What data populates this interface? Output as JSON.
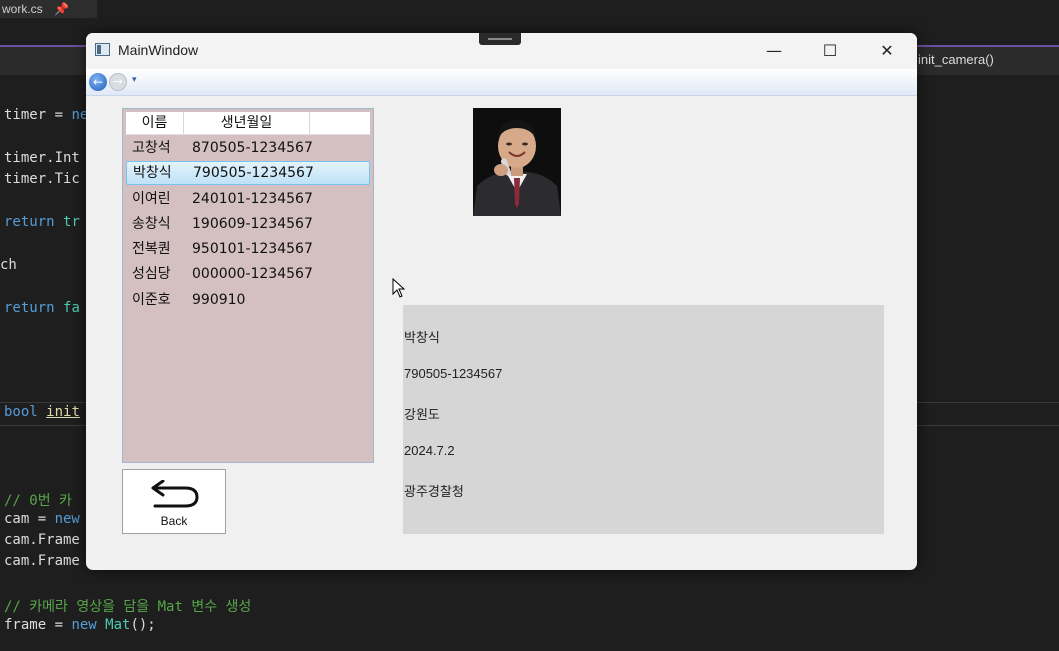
{
  "editor": {
    "tab_label": "work.cs",
    "tab_pin": "❀",
    "nav_function": "init_camera()",
    "lines": {
      "l1": "timer = ",
      "l1b": "ne",
      "l2": "timer.Int",
      "l3": "timer.Tic",
      "l4": "return ",
      "l4b": "tr",
      "l5": "ch",
      "l6": "return ",
      "l6b": "fa",
      "l7a": "bool ",
      "l7b": "init",
      "l8": "// 0번 카",
      "l9a": "cam = ",
      "l9b": "new",
      "l10": "cam.Frame",
      "l11": "cam.Frame",
      "l12": "// 카메라 영상을 담을 Mat 변수 생성",
      "l13a": "frame = ",
      "l13b": "new ",
      "l13c": "Mat",
      "l13d": "();"
    }
  },
  "window": {
    "title": "MainWindow",
    "minimize": "—",
    "maximize": "☐",
    "close": "✕",
    "nav": {
      "back_icon": "arrow-left-icon",
      "forward_icon": "arrow-right-icon",
      "back_glyph": "←",
      "forward_glyph": "→",
      "dropdown_glyph": "▾"
    }
  },
  "list": {
    "columns": [
      "이름",
      "생년월일"
    ],
    "rows": [
      {
        "name": "고창석",
        "birth": "870505-1234567"
      },
      {
        "name": "박창식",
        "birth": "790505-1234567"
      },
      {
        "name": "이여린",
        "birth": "240101-1234567"
      },
      {
        "name": "송창식",
        "birth": "190609-1234567"
      },
      {
        "name": "전복퀀",
        "birth": "950101-1234567"
      },
      {
        "name": "성심당",
        "birth": "000000-1234567"
      },
      {
        "name": "이준호",
        "birth": "990910"
      }
    ],
    "selected_index": 1
  },
  "back_button": {
    "label": "Back",
    "icon": "return-arrow-icon"
  },
  "details": {
    "name": "박창식",
    "birth": "790505-1234567",
    "region": "강원도",
    "date": "2024.7.2",
    "agency": "광주경찰청"
  },
  "colors": {
    "list_bg": "#d4c0c0",
    "info_bg": "#d6d6d6",
    "selection": "#bfe2f7",
    "editor_bg": "#1e1e1e"
  }
}
